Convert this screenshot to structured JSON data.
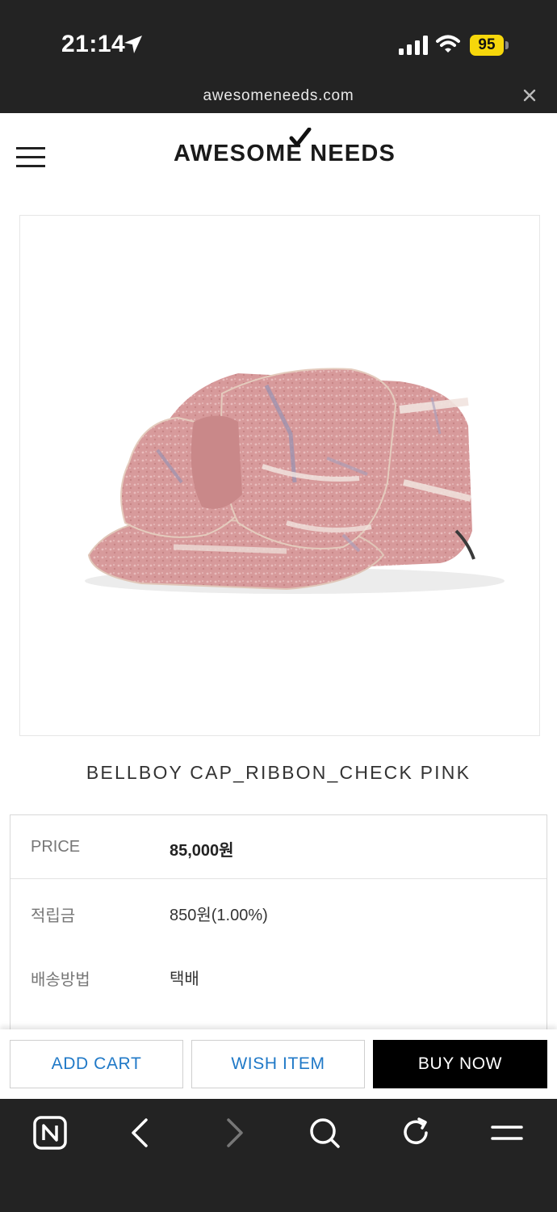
{
  "status_bar": {
    "time": "21:14",
    "battery": "95",
    "battery_color": "#f6d70b",
    "icons": [
      "location-arrow-icon",
      "signal-icon",
      "wifi-icon",
      "battery-icon"
    ]
  },
  "browser": {
    "url": "awesomeneeds.com",
    "close_icon": "close-icon",
    "toolbar_icons": [
      "naver-icon",
      "back-icon",
      "forward-icon",
      "search-icon",
      "reload-icon",
      "menu-icon"
    ]
  },
  "header": {
    "logo": "AWESOME NEEDS",
    "menu_icon": "hamburger-icon"
  },
  "product": {
    "name": "BELLBOY CAP_RIBBON_CHECK PINK",
    "image_alt": "pink tweed bellboy cap with ribbon"
  },
  "info": {
    "rows": [
      {
        "label": "PRICE",
        "value": "85,000원"
      },
      {
        "label": "적립금",
        "value": "850원(1.00%)"
      },
      {
        "label": "배송방법",
        "value": "택배"
      }
    ]
  },
  "actions": {
    "add_cart": "ADD CART",
    "wish_item": "WISH ITEM",
    "buy_now": "BUY NOW",
    "accent_color": "#2079c7"
  }
}
